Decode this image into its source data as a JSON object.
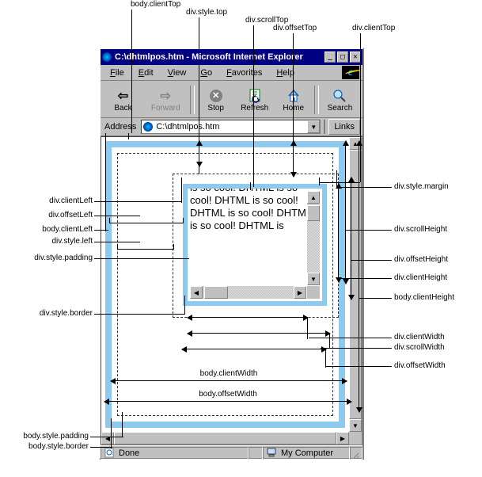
{
  "window": {
    "title": "C:\\dhtmlpos.htm - Microsoft Internet Explorer"
  },
  "menu": {
    "file": "File",
    "edit": "Edit",
    "view": "View",
    "go": "Go",
    "favorites": "Favorites",
    "help": "Help"
  },
  "toolbar": {
    "back": "Back",
    "forward": "Forward",
    "stop": "Stop",
    "refresh": "Refresh",
    "home": "Home",
    "search": "Search"
  },
  "address": {
    "label": "Address",
    "value": "C:\\dhtmlpos.htm",
    "links": "Links"
  },
  "status": {
    "done": "Done",
    "zone": "My Computer"
  },
  "content": {
    "text": "is so cool!\nDHTML is so cool! DHTML is so cool! DHTML is so cool! DHTML is so cool! DHTML is"
  },
  "callouts": {
    "body_clientTop": "body.clientTop",
    "div_style_top": "div.style.top",
    "div_scrollTop": "div.scrollTop",
    "div_offsetTop": "div.offsetTop",
    "div_clientTop": "div.clientTop",
    "div_style_margin": "div.style.margin",
    "div_clientLeft": "div.clientLeft",
    "div_offsetLeft": "div.offsetLeft",
    "body_clientLeft": "body.clientLeft",
    "div_style_left": "div.style.left",
    "div_style_padding": "div.style.padding",
    "div_style_border": "div.style.border",
    "div_scrollHeight": "div.scrollHeight",
    "div_offsetHeight": "div.offsetHeight",
    "div_clientHeight": "div.clientHeight",
    "body_clientHeight": "body.clientHeight",
    "div_clientWidth": "div.clientWidth",
    "div_scrollWidth": "div.scrollWidth",
    "div_offsetWidth": "div.offsetWidth",
    "body_clientWidth": "body.clientWidth",
    "body_offsetWidth": "body.offsetWidth",
    "body_style_padding": "body.style.padding",
    "body_style_border": "body.style.border"
  }
}
